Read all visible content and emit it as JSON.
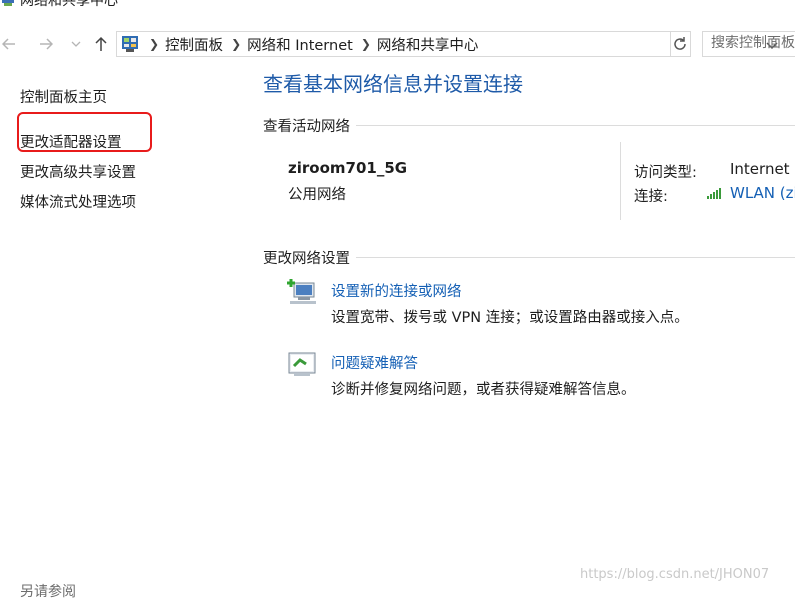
{
  "window": {
    "title": "网络和共享中心"
  },
  "nav": {
    "breadcrumbs": [
      "控制面板",
      "网络和 Internet",
      "网络和共享中心"
    ],
    "search_placeholder": "搜索控制面板"
  },
  "sidebar": {
    "items": [
      {
        "label": "控制面板主页"
      },
      {
        "label": "更改适配器设置",
        "highlighted": true
      },
      {
        "label": "更改高级共享设置"
      },
      {
        "label": "媒体流式处理选项"
      }
    ],
    "see_also": "另请参阅"
  },
  "main": {
    "title": "查看基本网络信息并设置连接",
    "active_networks_header": "查看活动网络",
    "network": {
      "name": "ziroom701_5G",
      "category": "公用网络",
      "access_type_label": "访问类型:",
      "access_type_value": "Internet",
      "connection_label": "连接:",
      "connection_value": "WLAN (zi"
    },
    "change_settings_header": "更改网络设置",
    "tasks": [
      {
        "link": "设置新的连接或网络",
        "desc": "设置宽带、拨号或 VPN 连接；或设置路由器或接入点。",
        "icon": "new-connection-icon"
      },
      {
        "link": "问题疑难解答",
        "desc": "诊断并修复网络问题，或者获得疑难解答信息。",
        "icon": "troubleshoot-icon"
      }
    ]
  },
  "watermark": "https://blog.csdn.net/JHON07",
  "colors": {
    "title_blue": "#1e5aa8",
    "link_blue": "#1560b5",
    "highlight_red": "#e81b1b",
    "divider": "#dcdcdc"
  }
}
